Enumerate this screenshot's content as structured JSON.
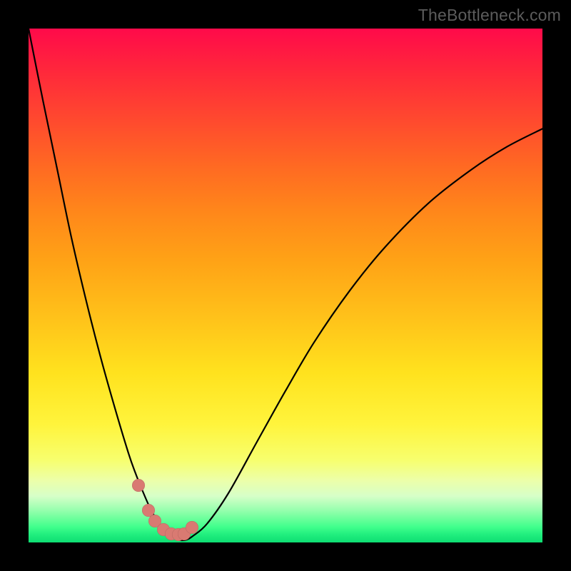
{
  "watermark": "TheBottleneck.com",
  "chart_data": {
    "type": "line",
    "title": "",
    "xlabel": "",
    "ylabel": "",
    "xlim": [
      0,
      100
    ],
    "ylim": [
      0,
      100
    ],
    "grid": false,
    "legend": false,
    "background": "rainbow-gradient-vertical",
    "series": [
      {
        "name": "bottleneck-curve",
        "color": "#000000",
        "x": [
          0.0,
          2.8,
          5.6,
          8.3,
          11.1,
          13.9,
          16.7,
          19.4,
          20.8,
          22.2,
          23.6,
          25.0,
          26.4,
          27.8,
          29.2,
          30.6,
          31.9,
          34.7,
          38.9,
          44.4,
          50.0,
          55.6,
          62.5,
          69.4,
          77.8,
          86.1,
          93.1,
          100.0
        ],
        "values": [
          100.0,
          86.0,
          72.5,
          59.5,
          47.5,
          36.5,
          26.5,
          17.5,
          13.5,
          10.0,
          6.8,
          4.3,
          2.4,
          1.2,
          0.5,
          0.5,
          1.2,
          3.6,
          9.6,
          19.5,
          29.5,
          39.0,
          49.0,
          57.5,
          66.0,
          72.5,
          77.0,
          80.5
        ]
      }
    ],
    "markers": {
      "name": "highlighted-points",
      "color": "#d97a72",
      "x": [
        21.4,
        23.4,
        24.6,
        26.2,
        27.8,
        29.2,
        30.3,
        31.8
      ],
      "values": [
        11.1,
        6.3,
        4.2,
        2.5,
        1.6,
        1.5,
        1.6,
        2.9
      ]
    }
  }
}
